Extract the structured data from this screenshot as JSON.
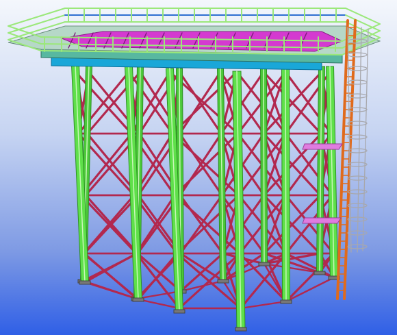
{
  "view": {
    "kind": "3d-structural-model",
    "background_top": "#f4f7fc",
    "background_bottom": "#2f5fe6"
  },
  "colors": {
    "column": "#5fe04a",
    "column_edge": "#2e8f24",
    "bracing": "#b2284e",
    "beam": "#1aa7d8",
    "deck": "#d43ad0",
    "handrail": "#9be87a",
    "handrail_dark": "#2e6fd1",
    "ladder": "#e06a1c",
    "cage": "#a8a8ac",
    "platform": "#e07ce0"
  },
  "model": {
    "columns": 10,
    "bracing_bays": 4,
    "intermediate_platforms": 2,
    "ladder": true,
    "safety_cage": true
  }
}
